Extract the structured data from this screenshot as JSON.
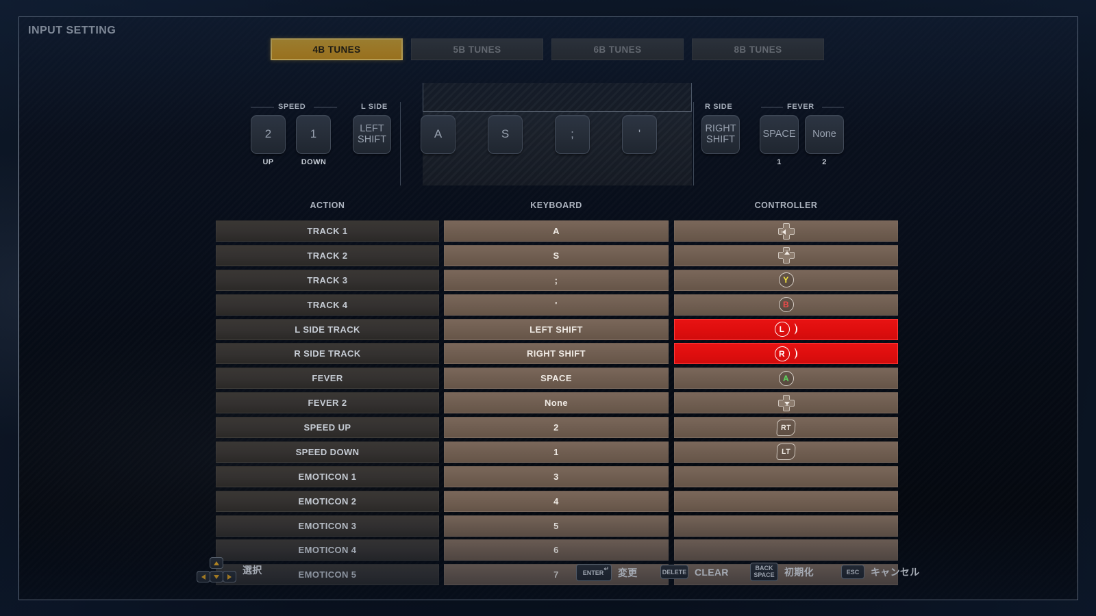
{
  "window": {
    "title": "INPUT SETTING"
  },
  "tabs": [
    {
      "label": "4B TUNES",
      "active": true
    },
    {
      "label": "5B TUNES",
      "active": false
    },
    {
      "label": "6B TUNES",
      "active": false
    },
    {
      "label": "8B TUNES",
      "active": false
    }
  ],
  "keylayout": {
    "speed": {
      "group_label": "SPEED",
      "keys": [
        {
          "cap": "2",
          "sub": "UP"
        },
        {
          "cap": "1",
          "sub": "DOWN"
        }
      ]
    },
    "lside": {
      "group_label": "L SIDE",
      "key": "LEFT\nSHIFT",
      "cap_line1": "LEFT",
      "cap_line2": "SHIFT"
    },
    "tracks": [
      {
        "cap": "A"
      },
      {
        "cap": "S"
      },
      {
        "cap": ";"
      },
      {
        "cap": "'"
      }
    ],
    "rside": {
      "group_label": "R SIDE",
      "cap_line1": "RIGHT",
      "cap_line2": "SHIFT"
    },
    "fever": {
      "group_label": "FEVER",
      "keys": [
        {
          "cap": "SPACE",
          "sub": "1"
        },
        {
          "cap": "None",
          "sub": "2"
        }
      ]
    }
  },
  "table": {
    "headers": {
      "action": "ACTION",
      "keyboard": "KEYBOARD",
      "controller": "CONTROLLER"
    },
    "rows": [
      {
        "action": "TRACK 1",
        "keyboard": "A",
        "controller_icon": "dpad-left",
        "alert": false
      },
      {
        "action": "TRACK 2",
        "keyboard": "S",
        "controller_icon": "dpad-up",
        "alert": false
      },
      {
        "action": "TRACK 3",
        "keyboard": ";",
        "controller_icon": "button-y",
        "controller_label": "Y",
        "alert": false
      },
      {
        "action": "TRACK 4",
        "keyboard": "'",
        "controller_icon": "button-b",
        "controller_label": "B",
        "alert": false
      },
      {
        "action": "L SIDE TRACK",
        "keyboard": "LEFT SHIFT",
        "controller_icon": "bumper-l",
        "controller_label": "L",
        "alert": true
      },
      {
        "action": "R SIDE TRACK",
        "keyboard": "RIGHT SHIFT",
        "controller_icon": "bumper-r",
        "controller_label": "R",
        "alert": true
      },
      {
        "action": "FEVER",
        "keyboard": "SPACE",
        "controller_icon": "button-a",
        "controller_label": "A",
        "alert": false
      },
      {
        "action": "FEVER 2",
        "keyboard": "None",
        "controller_icon": "dpad-down",
        "alert": false
      },
      {
        "action": "SPEED UP",
        "keyboard": "2",
        "controller_icon": "trigger-rt",
        "controller_label": "RT",
        "alert": false
      },
      {
        "action": "SPEED DOWN",
        "keyboard": "1",
        "controller_icon": "trigger-lt",
        "controller_label": "LT",
        "alert": false
      },
      {
        "action": "EMOTICON 1",
        "keyboard": "3",
        "controller_icon": "none",
        "alert": false
      },
      {
        "action": "EMOTICON 2",
        "keyboard": "4",
        "controller_icon": "none",
        "alert": false
      },
      {
        "action": "EMOTICON 3",
        "keyboard": "5",
        "controller_icon": "none",
        "alert": false
      },
      {
        "action": "EMOTICON 4",
        "keyboard": "6",
        "controller_icon": "none",
        "alert": false
      },
      {
        "action": "EMOTICON 5",
        "keyboard": "7",
        "controller_icon": "none",
        "alert": false
      }
    ]
  },
  "footer": {
    "hints": [
      {
        "key": "arrow-keys",
        "label": "選択"
      },
      {
        "key": "ENTER",
        "label": "変更"
      },
      {
        "key": "DELETE",
        "label": "CLEAR"
      },
      {
        "key": "BACK SPACE",
        "key_line1": "BACK",
        "key_line2": "SPACE",
        "label": "初期化"
      },
      {
        "key": "ESC",
        "label": "キャンセル"
      }
    ]
  },
  "colors": {
    "accent": "#e3a41c",
    "alert": "#de0e0e",
    "panel_bg": "#080e1a",
    "action_cell": "#343130",
    "value_cell": "#6f5d50"
  }
}
